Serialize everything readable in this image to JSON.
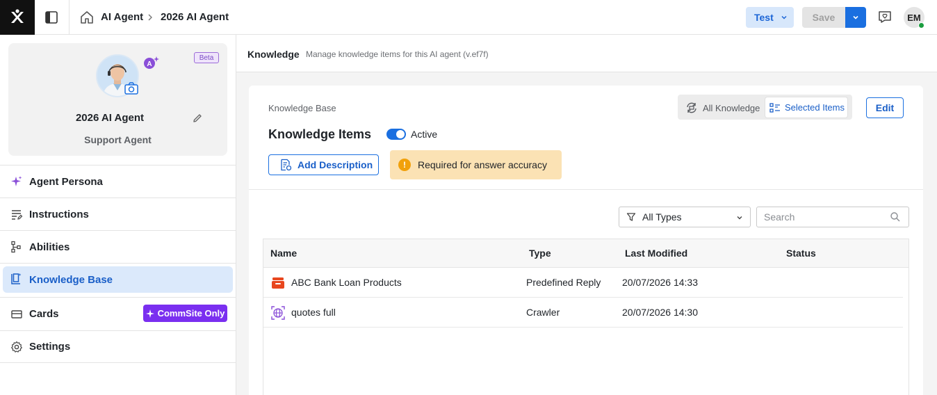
{
  "topbar": {
    "breadcrumb": [
      "AI Agent",
      "2026 AI Agent"
    ],
    "test_label": "Test",
    "save_label": "Save",
    "user_initials": "EM"
  },
  "profile": {
    "beta_label": "Beta",
    "name": "2026 AI Agent",
    "role": "Support Agent"
  },
  "sidebar": {
    "items": [
      {
        "label": "Agent Persona",
        "icon": "sparkle-icon"
      },
      {
        "label": "Instructions",
        "icon": "list-edit-icon"
      },
      {
        "label": "Abilities",
        "icon": "tree-icon"
      },
      {
        "label": "Knowledge Base",
        "icon": "knowledge-icon",
        "active": true
      },
      {
        "label": "Cards",
        "icon": "cards-icon"
      },
      {
        "label": "Settings",
        "icon": "gear-icon"
      }
    ],
    "commsite_label": "CommSite Only"
  },
  "main": {
    "title": "Knowledge",
    "subtitle": "Manage knowledge items for this AI agent (v.ef7f)",
    "kb_label": "Knowledge Base",
    "items_title": "Knowledge Items",
    "active_label": "Active",
    "seg_all": "All Knowledge",
    "seg_selected": "Selected Items",
    "edit_label": "Edit",
    "add_desc_label": "Add Description",
    "warning": "Required for answer accuracy",
    "type_filter": "All Types",
    "search_placeholder": "Search",
    "columns": [
      "Name",
      "Type",
      "Last Modified",
      "Status"
    ],
    "rows": [
      {
        "name": "ABC Bank Loan Products",
        "type": "Predefined Reply",
        "modified": "20/07/2026 14:33",
        "status": ""
      },
      {
        "name": "quotes full",
        "type": "Crawler",
        "modified": "20/07/2026 14:30",
        "status": ""
      }
    ]
  },
  "colors": {
    "accent": "#1a6fe0",
    "active_nav_bg": "#dbe9fb",
    "commsite": "#7a2ff0",
    "warning_bg": "#fbe2b4"
  }
}
